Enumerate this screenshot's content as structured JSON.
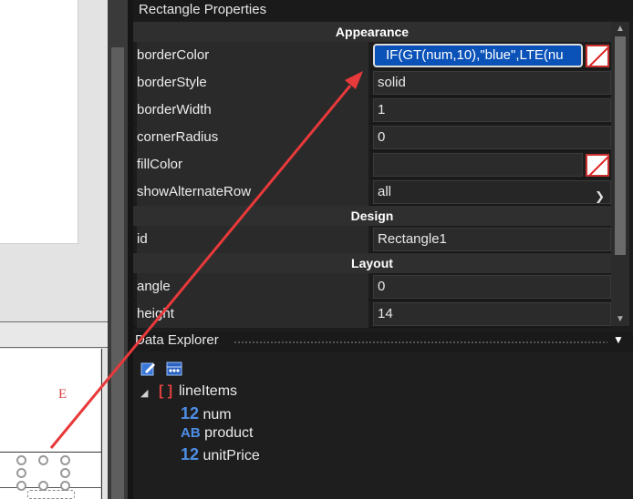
{
  "properties": {
    "title": "Rectangle Properties",
    "categories": {
      "appearance": "Appearance",
      "design": "Design",
      "layout": "Layout"
    },
    "rows": {
      "borderColor": {
        "name": "borderColor",
        "value": "IF(GT(num,10),\"blue\",LTE(nu"
      },
      "borderStyle": {
        "name": "borderStyle",
        "value": "solid"
      },
      "borderWidth": {
        "name": "borderWidth",
        "value": "1"
      },
      "cornerRadius": {
        "name": "cornerRadius",
        "value": "0"
      },
      "fillColor": {
        "name": "fillColor",
        "value": ""
      },
      "showAlternateRow": {
        "name": "showAlternateRow",
        "value": "all"
      },
      "id": {
        "name": "id",
        "value": "Rectangle1"
      },
      "angle": {
        "name": "angle",
        "value": "0"
      },
      "height": {
        "name": "height",
        "value": "14"
      }
    }
  },
  "explorer": {
    "title": "Data Explorer",
    "tree": {
      "root": {
        "icon": "[ ]",
        "label": "lineItems"
      },
      "fields": [
        {
          "type_icon": "12",
          "label": "num"
        },
        {
          "type_icon": "AB",
          "label": "product"
        },
        {
          "type_icon": "12",
          "label": "unitPrice"
        }
      ]
    }
  },
  "canvas": {
    "letter": "E"
  },
  "colors": {
    "selected_field": "#0a52b8",
    "arrow": "#e8393b",
    "type_icon": "#4e8fe6"
  }
}
